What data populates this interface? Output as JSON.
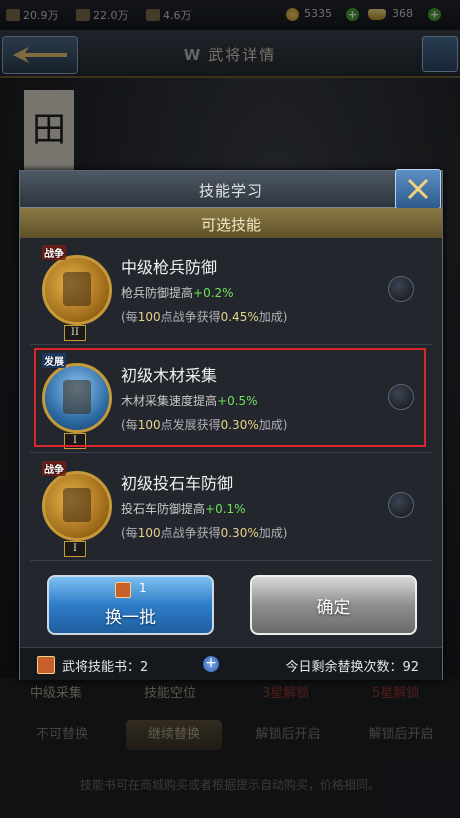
{
  "topbar": {
    "res1": "20.9万",
    "res2": "22.0万",
    "res3": "4.6万",
    "gold": "5335",
    "ingot": "368"
  },
  "header": {
    "title": "武将详情",
    "title_icon": "W"
  },
  "background": {
    "banner": "田",
    "row": [
      "中级采集",
      "技能空位",
      "3星解锁",
      "5星解锁"
    ],
    "tabs": [
      "不可替换",
      "继续替换",
      "解锁后开启",
      "解锁后开启"
    ],
    "note": "技能书可在商城购买或者根据提示自动购买，价格相同。"
  },
  "dialog": {
    "title": "技能学习",
    "subtitle": "可选技能",
    "skills": [
      {
        "tag": "战争",
        "level": "II",
        "name": "中级枪兵防御",
        "desc": "枪兵防御提高",
        "bonus": "+0.2%",
        "note_pre": "(每",
        "note_num": "100",
        "note_mid": "点战争获得",
        "note_val": "0.45%",
        "note_post": "加成)"
      },
      {
        "tag": "发展",
        "level": "I",
        "name": "初级木材采集",
        "desc": "木材采集速度提高",
        "bonus": "+0.5%",
        "note_pre": "(每",
        "note_num": "100",
        "note_mid": "点发展获得",
        "note_val": "0.30%",
        "note_post": "加成)"
      },
      {
        "tag": "战争",
        "level": "I",
        "name": "初级投石车防御",
        "desc": "投石车防御提高",
        "bonus": "+0.1%",
        "note_pre": "(每",
        "note_num": "100",
        "note_mid": "点战争获得",
        "note_val": "0.30%",
        "note_post": "加成)"
      }
    ],
    "refresh_button": {
      "count": "1",
      "label": "换一批"
    },
    "confirm_button": {
      "label": "确定"
    },
    "footer": {
      "books_label": "武将技能书：",
      "books_count": "2",
      "remaining_label": "今日剩余替换次数：",
      "remaining_count": "92"
    }
  },
  "colors": {
    "bonus_green": "#6fe05a",
    "highlight_red": "#d9282c",
    "header_gold": "#8a7a45"
  }
}
